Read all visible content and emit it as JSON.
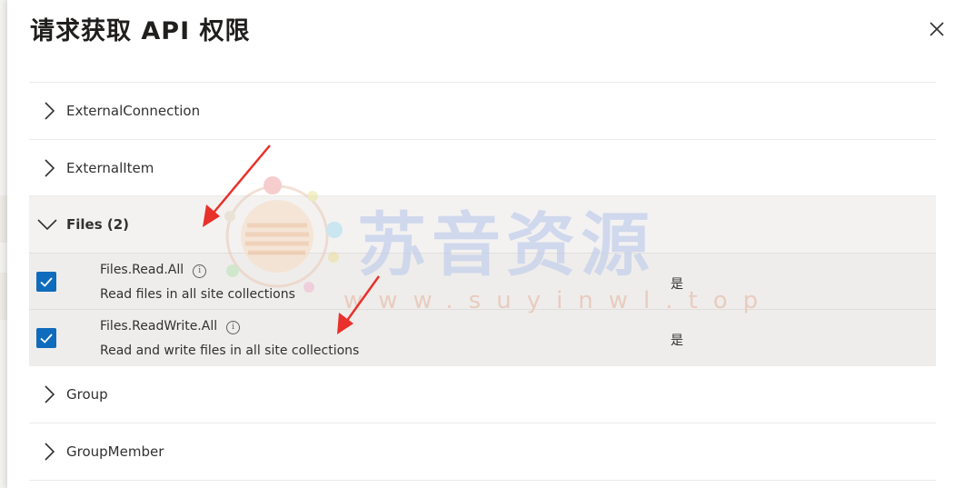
{
  "panel": {
    "title": "请求获取 API 权限",
    "close_icon": "close-icon"
  },
  "groups": [
    {
      "label": "ExternalConnection",
      "expanded": false
    },
    {
      "label": "ExternalItem",
      "expanded": false
    },
    {
      "label": "Files (2)",
      "expanded": true
    },
    {
      "label": "Group",
      "expanded": false
    },
    {
      "label": "GroupMember",
      "expanded": false
    }
  ],
  "permissions": [
    {
      "name": "Files.Read.All",
      "description": "Read files in all site collections",
      "admin_consent": "是",
      "checked": true
    },
    {
      "name": "Files.ReadWrite.All",
      "description": "Read and write files in all site collections",
      "admin_consent": "是",
      "checked": true
    }
  ],
  "watermark": {
    "text": "苏音资源",
    "url": "www.suyinwl.top"
  },
  "colors": {
    "accent": "#0f6cbd",
    "annotation_arrow": "#e8312a",
    "expanded_bg": "#f3f2f1"
  }
}
